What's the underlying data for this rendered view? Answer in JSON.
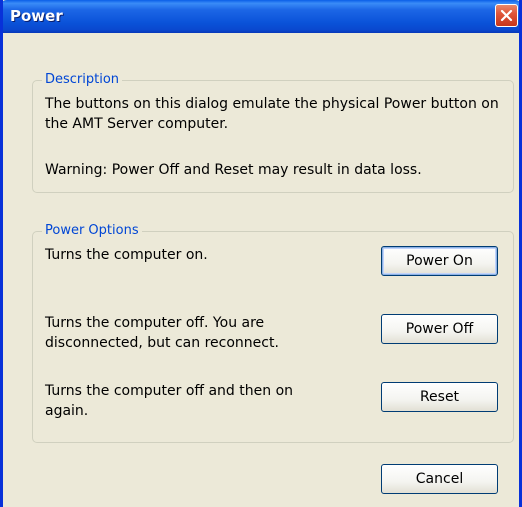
{
  "window": {
    "title": "Power",
    "close_icon": "close-icon"
  },
  "description": {
    "legend": "Description",
    "text": "The buttons on this dialog emulate the physical Power button on the AMT Server computer.",
    "warning": "Warning: Power Off and Reset may result in data loss."
  },
  "power_options": {
    "legend": "Power Options",
    "on": {
      "text": "Turns the computer on.",
      "button": "Power On"
    },
    "off": {
      "text": "Turns the computer off. You are disconnected, but can reconnect.",
      "button": "Power Off"
    },
    "reset": {
      "text": "Turns the computer off and then on again.",
      "button": "Reset"
    }
  },
  "footer": {
    "cancel": "Cancel"
  },
  "colors": {
    "titlebar": "#0a52d8",
    "dialog_bg": "#ece9d8",
    "legend_text": "#0046d5",
    "close_button": "#e0563a"
  }
}
